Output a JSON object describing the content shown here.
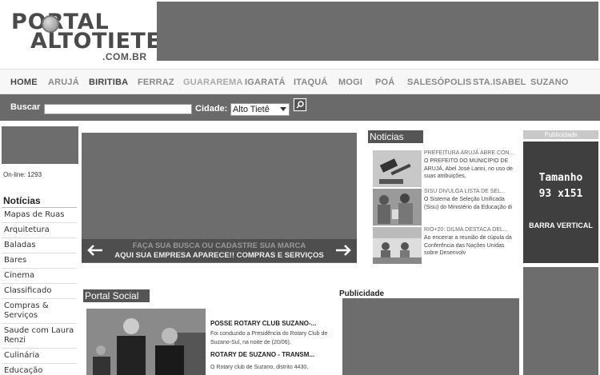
{
  "logo": {
    "line1": "PORTAL",
    "line2": "ALTOTIETE",
    "line3": ".COM.BR"
  },
  "nav": {
    "items": [
      {
        "label": "HOME",
        "tone": "dark"
      },
      {
        "label": "ARUJÁ",
        "tone": "light"
      },
      {
        "label": "BIRITIBA",
        "tone": "dark"
      },
      {
        "label": "FERRAZ",
        "tone": "light"
      },
      {
        "label": "GUARAREMA",
        "tone": "lighter"
      },
      {
        "label": "IGARATÁ",
        "tone": "light"
      },
      {
        "label": "ITAQUÁ",
        "tone": "light"
      },
      {
        "label": "MOGI",
        "tone": "light"
      },
      {
        "label": "POÁ",
        "tone": "light"
      },
      {
        "label": "SALESÓPOLIS",
        "tone": "light"
      },
      {
        "label": "STA.ISABEL",
        "tone": "light"
      },
      {
        "label": "SUZANO",
        "tone": "light"
      }
    ]
  },
  "search": {
    "label": "Buscar",
    "value": "",
    "city_label": "Cidade:",
    "city_selected": "Alto Tietê"
  },
  "sidebar": {
    "online": "On-line: 1293",
    "menu_title": "Notícias",
    "items": [
      "Mapas de Ruas",
      "Arquitetura",
      "Baladas",
      "Bares",
      "Cinema",
      "Classificado",
      "Compras & Serviços",
      "Saude com Laura Renzi",
      "Culinária",
      "Educação"
    ]
  },
  "slider": {
    "caption1": "FAÇA SUA BUSCA OU CADASTRE SUA MARCA",
    "caption2": "AQUI SUA EMPRESA APARECE!! COMPRAS E SERVIÇOS"
  },
  "news": {
    "title": "Noticias",
    "items": [
      {
        "headline": "PREFEITURA ARUJÁ ABRE CON...",
        "text": "O PREFEITO DO MUNICÍPIO DE ARUJÁ, Abel José Larini, no uso de suas atribuições,"
      },
      {
        "headline": "SISU DIVULGA LISTA DE SEL...",
        "text": "O Sistema de Seleção Unificada (Sisu) do Ministério da Educação di"
      },
      {
        "headline": "RIO+20: DILMA DESTACA DEL...",
        "text": "Ao encerrar a reunião de cúpula da Conferência das Nações Unidas sobre Desenvolv"
      }
    ]
  },
  "right_pub": {
    "label": "Publicidade",
    "size_label": "Tamanho",
    "size": "93 x151",
    "format": "BARRA VERTICAL"
  },
  "social": {
    "title": "Portal Social",
    "items": [
      {
        "headline": "POSSE ROTARY CLUB SUZANO-...",
        "text": "Foi conduzido a Presidência do Rotary Club de Suzano-Sul, na noite de (20/06),"
      },
      {
        "headline": "ROTARY DE SUZANO - TRANSM...",
        "text": "O Rotary club de Suzano, distrito 4430,"
      }
    ]
  },
  "mid_pub": {
    "label": "Publicidade"
  }
}
